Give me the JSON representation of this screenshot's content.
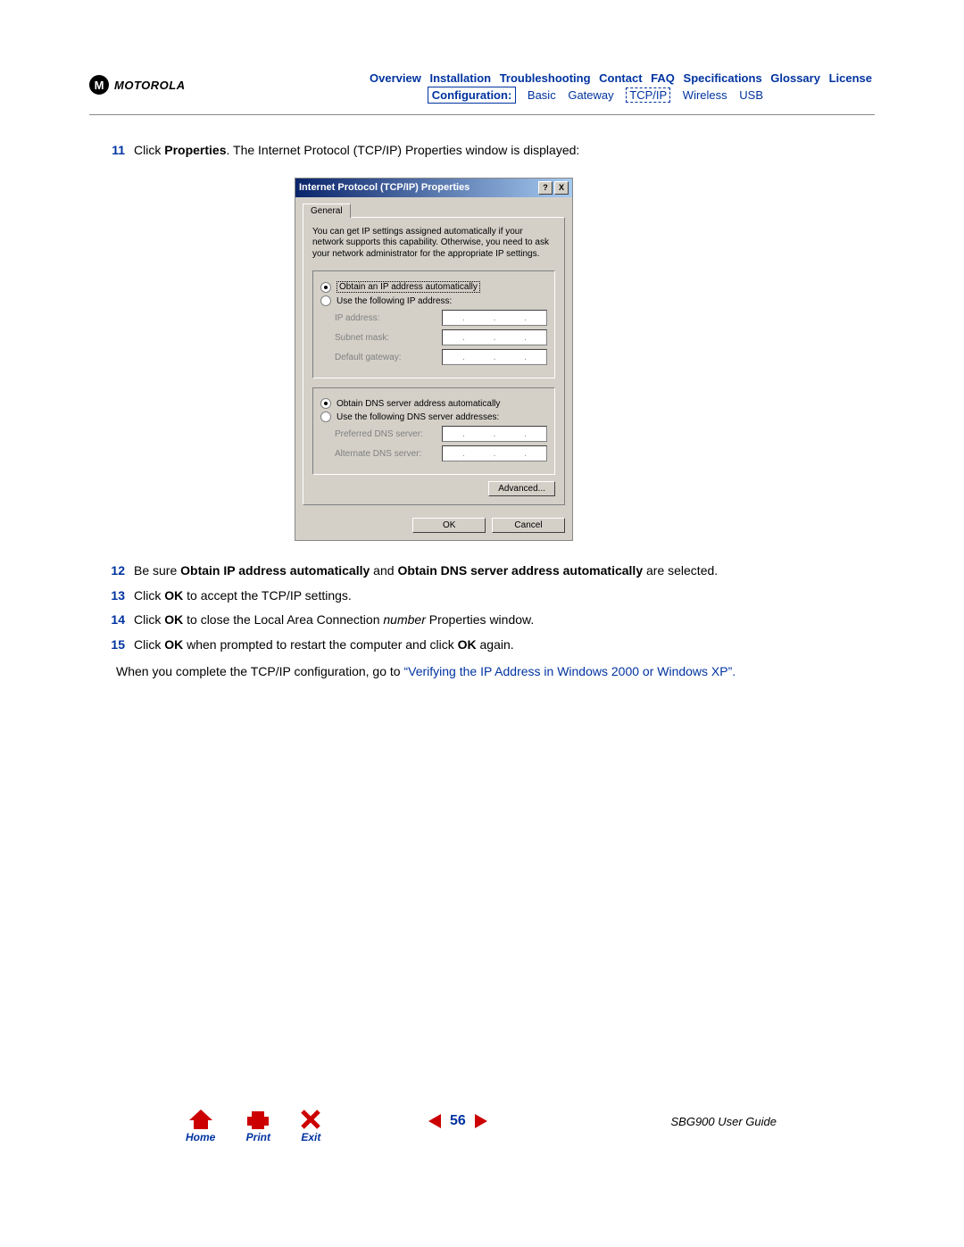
{
  "brand": "MOTOROLA",
  "nav_top": [
    "Overview",
    "Installation",
    "Troubleshooting",
    "Contact",
    "FAQ",
    "Specifications",
    "Glossary",
    "License"
  ],
  "nav_sub_label": "Configuration:",
  "nav_sub": [
    "Basic",
    "Gateway",
    "TCP/IP",
    "Wireless",
    "USB"
  ],
  "steps": {
    "s11": {
      "num": "11",
      "pre": "Click ",
      "bold": "Properties",
      "post": ". The Internet Protocol (TCP/IP) Properties window is displayed:"
    },
    "s12": {
      "num": "12",
      "pre": "Be sure ",
      "b1": "Obtain IP address automatically",
      "mid": " and ",
      "b2": "Obtain DNS server address automatically",
      "post": " are selected."
    },
    "s13": {
      "num": "13",
      "pre": "Click ",
      "b1": "OK",
      "post": " to accept the TCP/IP settings."
    },
    "s14": {
      "num": "14",
      "pre": "Click ",
      "b1": "OK",
      "mid": " to close the Local Area Connection ",
      "it": "number",
      "post": " Properties window."
    },
    "s15": {
      "num": "15",
      "pre": "Click ",
      "b1": "OK",
      "mid": " when prompted to restart the computer and click ",
      "b2": "OK",
      "post": " again."
    }
  },
  "closing_pre": "When you complete the TCP/IP configuration, go to ",
  "closing_q1": "“",
  "closing_link": "Verifying the IP Address in Windows 2000 or Windows XP",
  "closing_q2": "”.",
  "dialog": {
    "title": "Internet Protocol (TCP/IP) Properties",
    "tab": "General",
    "intro": "You can get IP settings assigned automatically if your network supports this capability. Otherwise, you need to ask your network administrator for the appropriate IP settings.",
    "r1": "Obtain an IP address automatically",
    "r2": "Use the following IP address:",
    "f1": "IP address:",
    "f2": "Subnet mask:",
    "f3": "Default gateway:",
    "r3": "Obtain DNS server address automatically",
    "r4": "Use the following DNS server addresses:",
    "f4": "Preferred DNS server:",
    "f5": "Alternate DNS server:",
    "adv": "Advanced...",
    "ok": "OK",
    "cancel": "Cancel",
    "help": "?",
    "close": "X"
  },
  "footer": {
    "home": "Home",
    "print": "Print",
    "exit": "Exit",
    "page": "56",
    "guide": "SBG900 User Guide"
  }
}
